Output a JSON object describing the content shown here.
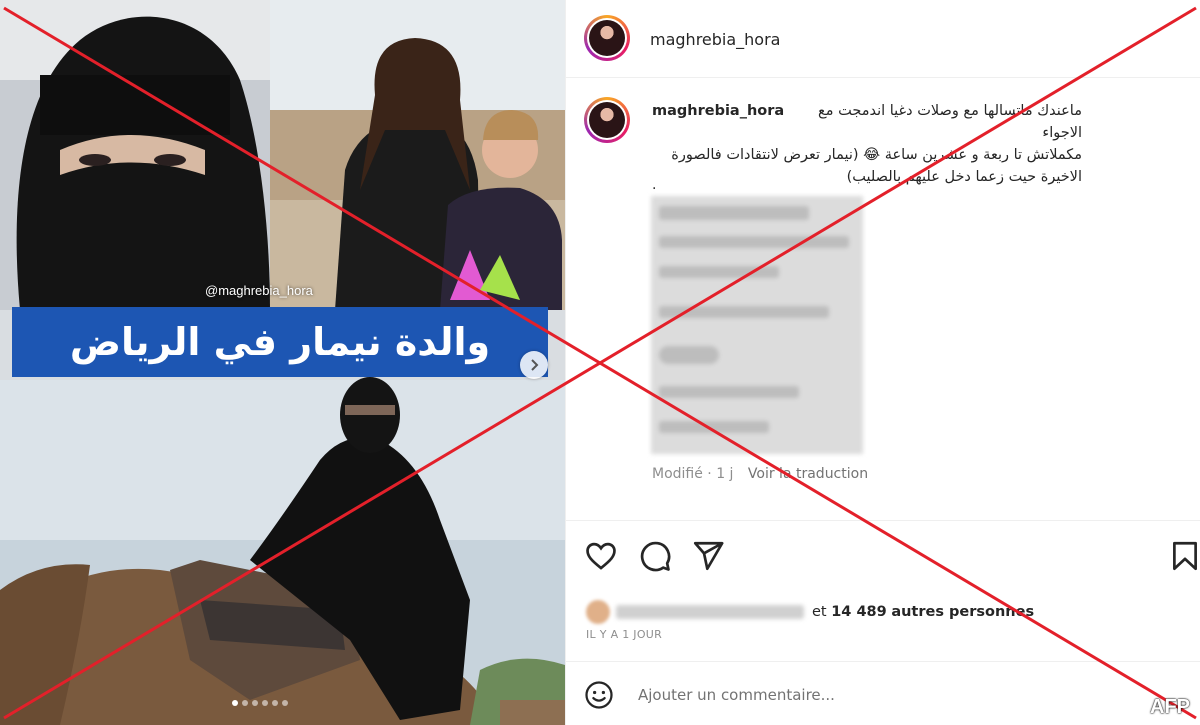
{
  "media": {
    "overlay_handle": "@maghrebia_hora",
    "banner_title": "والدة نيمار في الرياض",
    "carousel_dots": 6,
    "active_dot": 1
  },
  "header": {
    "username": "maghrebia_hora"
  },
  "caption": {
    "username": "maghrebia_hora",
    "line1": "ماعندك ماتسالها مع وصلات دغيا اندمجت مع الاجواء",
    "line2": "مكملاتش تا ربعة و عشرين ساعة 😂 (نيمار تعرض لانتقادات فالصورة",
    "line3": "الاخيرة حيت زعما دخل عليهم بالصليب)",
    "dot": "."
  },
  "meta": {
    "edited": "Modifié · 1 j",
    "translate": "Voir la traduction"
  },
  "actions": {
    "icons": [
      "heart-icon",
      "comment-icon",
      "share-icon",
      "bookmark-icon"
    ]
  },
  "likes": {
    "prefix": "et",
    "count": "14 489",
    "suffix": "autres personnes"
  },
  "time": "IL Y A 1 JOUR",
  "comment": {
    "placeholder": "Ajouter un commentaire..."
  },
  "watermark": "AFP",
  "colors": {
    "banner": "#1d56b3",
    "cross": "#e3202a",
    "border": "#efefef"
  }
}
